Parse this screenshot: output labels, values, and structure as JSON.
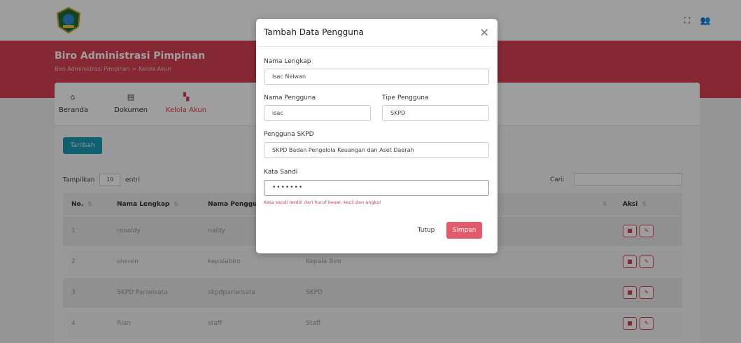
{
  "topbar": {
    "expand_icon": "expand-icon",
    "user_icon": "user-icon"
  },
  "header": {
    "title": "Biro Administrasi Pimpinan",
    "breadcrumb": [
      "Biro Administrasi Pimpinan",
      ">",
      "Kelola Akun"
    ]
  },
  "nav": {
    "items": [
      {
        "label": "Beranda",
        "icon": "home-icon"
      },
      {
        "label": "Dokumen",
        "icon": "document-icon"
      },
      {
        "label": "Kelola Akun",
        "icon": "account-icon"
      }
    ]
  },
  "table_controls": {
    "add_label": "Tambah",
    "show_label": "Tampilkan",
    "entries_value": "10",
    "entries_label": "entri",
    "search_label": "Cari:"
  },
  "table": {
    "headers": [
      "No.",
      "Nama Lengkap",
      "Nama Pengguna",
      "",
      "",
      "Aksi"
    ],
    "rows": [
      [
        "1",
        "renaldy",
        "naldy",
        "",
        ""
      ],
      [
        "2",
        "sheren",
        "kepalabiro",
        "Kepala Biro",
        ""
      ],
      [
        "3",
        "SKPD Pariwisata",
        "skpdpariwisata",
        "SKPD",
        ""
      ],
      [
        "4",
        "Rian",
        "staff",
        "Staff",
        ""
      ]
    ]
  },
  "modal": {
    "title": "Tambah Data Pengguna",
    "full_name_label": "Nama Lengkap",
    "full_name_value": "Isac Nelwan",
    "username_label": "Nama Pengguna",
    "username_value": "isac",
    "user_type_label": "Tipe Pengguna",
    "user_type_value": "SKPD",
    "skpd_label": "Pengguna SKPD",
    "skpd_value": "SKPD Badan Pengelola Keuangan dan Aset Daerah",
    "password_label": "Kata Sandi",
    "password_value": "•••••••",
    "password_hint": "Kata sandi terdiri dari huruf besar, kecil dan angka!",
    "close_label": "Tutup",
    "save_label": "Simpan"
  },
  "colors": {
    "accent": "#d94155",
    "primary_button": "#1b9bb8"
  }
}
